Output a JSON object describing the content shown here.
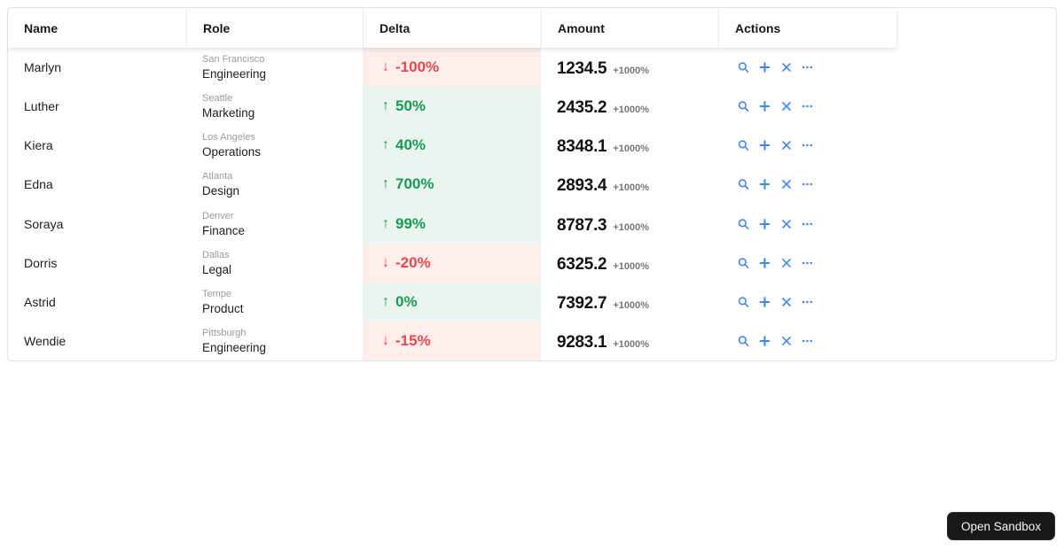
{
  "table": {
    "columns": [
      {
        "id": "name",
        "label": "Name"
      },
      {
        "id": "role",
        "label": "Role"
      },
      {
        "id": "delta",
        "label": "Delta"
      },
      {
        "id": "amount",
        "label": "Amount"
      },
      {
        "id": "actions",
        "label": "Actions"
      }
    ],
    "icons": {
      "trend_up": "↑",
      "trend_down": "↓"
    },
    "action_icons": [
      "search",
      "add",
      "close",
      "more"
    ],
    "rows": [
      {
        "name": "Marlyn",
        "city": "San Francisco",
        "department": "Engineering",
        "delta": "-100%",
        "direction": "down",
        "amount": "1234.5",
        "change": "+1000%"
      },
      {
        "name": "Luther",
        "city": "Seattle",
        "department": "Marketing",
        "delta": "50%",
        "direction": "up",
        "amount": "2435.2",
        "change": "+1000%"
      },
      {
        "name": "Kiera",
        "city": "Los Angeles",
        "department": "Operations",
        "delta": "40%",
        "direction": "up",
        "amount": "8348.1",
        "change": "+1000%"
      },
      {
        "name": "Edna",
        "city": "Atlanta",
        "department": "Design",
        "delta": "700%",
        "direction": "up",
        "amount": "2893.4",
        "change": "+1000%"
      },
      {
        "name": "Soraya",
        "city": "Denver",
        "department": "Finance",
        "delta": "99%",
        "direction": "up",
        "amount": "8787.3",
        "change": "+1000%"
      },
      {
        "name": "Dorris",
        "city": "Dallas",
        "department": "Legal",
        "delta": "-20%",
        "direction": "down",
        "amount": "6325.2",
        "change": "+1000%"
      },
      {
        "name": "Astrid",
        "city": "Tempe",
        "department": "Product",
        "delta": "0%",
        "direction": "up",
        "amount": "7392.7",
        "change": "+1000%"
      },
      {
        "name": "Wendie",
        "city": "Pittsburgh",
        "department": "Engineering",
        "delta": "-15%",
        "direction": "down",
        "amount": "9283.1",
        "change": "+1000%"
      }
    ]
  },
  "colors": {
    "delta_positive_text": "#169b54",
    "delta_positive_bg": "#e9f5ee",
    "delta_negative_text": "#e5484d",
    "delta_negative_bg": "#fdeeec",
    "action_icon": "#4285f4",
    "button_bg": "#18181b",
    "button_text": "#f5f5f5"
  },
  "sandbox": {
    "label": "Open Sandbox"
  }
}
